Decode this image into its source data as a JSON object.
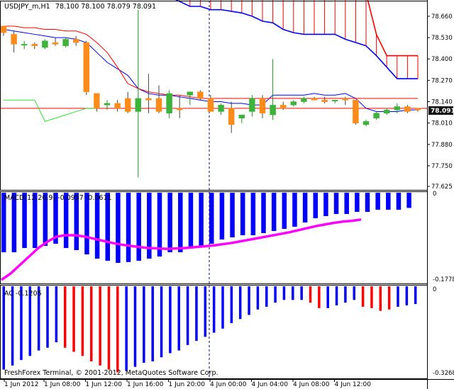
{
  "chart_data": [
    {
      "type": "candlestick",
      "title": "USDJPY_m,H1",
      "ohlc_text": "78.100 78.100 78.079 78.091",
      "current_price": "78.091",
      "price_ticks": [
        "78.660",
        "78.530",
        "78.400",
        "78.270",
        "78.140",
        "78.010",
        "77.880",
        "77.750",
        "77.625"
      ],
      "ylim": [
        77.625,
        78.72
      ],
      "time_ticks": [
        "1 Jun 2012",
        "1 Jun 08:00",
        "1 Jun 12:00",
        "1 Jun 16:00",
        "1 Jun 20:00",
        "4 Jun 00:00",
        "4 Jun 04:00",
        "4 Jun 08:00",
        "4 Jun 12:00"
      ],
      "candles": [
        [
          78.6,
          78.6,
          78.54,
          78.56
        ],
        [
          78.55,
          78.57,
          78.44,
          78.49
        ],
        [
          78.49,
          78.51,
          78.46,
          78.49
        ],
        [
          78.49,
          78.5,
          78.46,
          78.48
        ],
        [
          78.47,
          78.52,
          78.46,
          78.51
        ],
        [
          78.5,
          78.53,
          78.48,
          78.49
        ],
        [
          78.48,
          78.53,
          78.47,
          78.52
        ],
        [
          78.52,
          78.54,
          78.48,
          78.5
        ],
        [
          78.5,
          78.51,
          78.18,
          78.2
        ],
        [
          78.19,
          78.19,
          78.08,
          78.1
        ],
        [
          78.12,
          78.15,
          78.09,
          78.13
        ],
        [
          78.13,
          78.15,
          78.08,
          78.1
        ],
        [
          78.16,
          78.2,
          78.07,
          78.08
        ],
        [
          78.08,
          78.7,
          77.68,
          78.16
        ],
        [
          78.16,
          78.31,
          78.07,
          78.15
        ],
        [
          78.16,
          78.24,
          78.07,
          78.08
        ],
        [
          78.07,
          78.21,
          78.04,
          78.19
        ],
        [
          78.1,
          78.18,
          78.04,
          78.09
        ],
        [
          78.18,
          78.2,
          78.12,
          78.2
        ],
        [
          78.2,
          78.21,
          78.15,
          78.16
        ],
        [
          78.16,
          78.18,
          78.08,
          78.08
        ],
        [
          78.08,
          78.13,
          78.06,
          78.12
        ],
        [
          78.1,
          78.14,
          77.95,
          78.0
        ],
        [
          78.04,
          78.06,
          78.01,
          78.06
        ],
        [
          78.08,
          78.18,
          78.05,
          78.16
        ],
        [
          78.16,
          78.18,
          78.04,
          78.07
        ],
        [
          78.06,
          78.4,
          78.03,
          78.12
        ],
        [
          78.12,
          78.14,
          78.09,
          78.1
        ],
        [
          78.12,
          78.15,
          78.11,
          78.14
        ],
        [
          78.14,
          78.17,
          78.13,
          78.16
        ],
        [
          78.16,
          78.17,
          78.15,
          78.15
        ],
        [
          78.15,
          78.17,
          78.13,
          78.14
        ],
        [
          78.15,
          78.15,
          78.13,
          78.15
        ],
        [
          78.16,
          78.17,
          78.12,
          78.15
        ],
        [
          78.15,
          78.15,
          78.0,
          78.01
        ],
        [
          78.0,
          78.03,
          77.99,
          78.02
        ],
        [
          78.04,
          78.08,
          78.03,
          78.07
        ],
        [
          78.07,
          78.1,
          78.06,
          78.09
        ],
        [
          78.09,
          78.13,
          78.07,
          78.11
        ],
        [
          78.11,
          78.12,
          78.07,
          78.08
        ],
        [
          78.1,
          78.1,
          78.08,
          78.09
        ]
      ],
      "tenkan_sen": [
        78.58,
        78.57,
        78.56,
        78.55,
        78.54,
        78.53,
        78.53,
        78.52,
        78.5,
        78.44,
        78.38,
        78.34,
        78.3,
        78.22,
        78.19,
        78.18,
        78.18,
        78.17,
        78.16,
        78.15,
        78.14,
        78.14,
        78.13,
        78.13,
        78.12,
        78.12,
        78.18,
        78.18,
        78.18,
        78.18,
        78.19,
        78.18,
        78.18,
        78.19,
        78.16,
        78.1,
        78.08,
        78.08,
        78.08,
        78.09,
        78.09
      ],
      "kijun_sen": [
        78.6,
        78.6,
        78.59,
        78.59,
        78.58,
        78.58,
        78.57,
        78.57,
        78.55,
        78.5,
        78.44,
        78.35,
        78.25,
        78.22,
        78.2,
        78.19,
        78.18,
        78.18,
        78.17,
        78.16,
        78.16,
        78.16,
        78.16,
        78.16,
        78.16,
        78.16,
        78.16,
        78.16,
        78.16,
        78.16,
        78.16,
        78.16,
        78.16,
        78.16,
        78.16,
        78.16,
        78.16,
        78.16,
        78.16,
        78.16,
        78.16
      ],
      "chikou_span": [
        78.15,
        78.15,
        78.15,
        78.15,
        78.02,
        78.04,
        78.06,
        78.08,
        78.1,
        78.1
      ],
      "senkou_span_a": [
        78.8,
        78.8,
        78.78,
        78.75,
        78.72,
        78.72,
        78.7,
        78.7,
        78.69,
        78.68,
        78.66,
        78.63,
        78.62,
        78.58,
        78.56,
        78.55,
        78.55,
        78.55,
        78.55,
        78.52,
        78.5,
        78.48,
        78.42,
        78.35,
        78.28,
        78.28,
        78.28
      ],
      "senkou_span_b": [
        78.8,
        78.8,
        78.8,
        78.8,
        78.8,
        78.8,
        78.8,
        78.8,
        78.8,
        78.8,
        78.8,
        78.8,
        78.8,
        78.8,
        78.8,
        78.8,
        78.8,
        78.8,
        78.8,
        78.8,
        78.8,
        78.8,
        78.55,
        78.42,
        78.42,
        78.42,
        78.42
      ],
      "kumo_start_index": 14,
      "horizontal_line": 78.1,
      "colors": {
        "bull": "#3cb43c",
        "bear": "#ff8c1a",
        "tenkan": "#ff0000",
        "kijun": "#0000ff",
        "chikou": "#33dd33",
        "kumo": "#ff0000"
      }
    },
    {
      "type": "bar",
      "label": "MACD(12,26,9) -0.0957 -0.0611",
      "yticks": [
        "0",
        "-0.1778"
      ],
      "ylim": [
        -0.21,
        0
      ],
      "histogram": [
        -0.14,
        -0.14,
        -0.13,
        -0.13,
        -0.125,
        -0.12,
        -0.13,
        -0.135,
        -0.145,
        -0.155,
        -0.16,
        -0.165,
        -0.163,
        -0.16,
        -0.155,
        -0.15,
        -0.14,
        -0.14,
        -0.13,
        -0.125,
        -0.12,
        -0.11,
        -0.105,
        -0.1,
        -0.1,
        -0.095,
        -0.09,
        -0.085,
        -0.08,
        -0.07,
        -0.06,
        -0.055,
        -0.05,
        -0.05,
        -0.045,
        -0.045,
        -0.04,
        -0.04,
        -0.04,
        -0.0357
      ],
      "signal": [
        -0.205,
        -0.19,
        -0.17,
        -0.15,
        -0.13,
        -0.115,
        -0.103,
        -0.1,
        -0.1,
        -0.103,
        -0.108,
        -0.113,
        -0.118,
        -0.122,
        -0.125,
        -0.128,
        -0.13,
        -0.131,
        -0.132,
        -0.131,
        -0.13,
        -0.128,
        -0.126,
        -0.124,
        -0.121,
        -0.118,
        -0.114,
        -0.11,
        -0.106,
        -0.102,
        -0.098,
        -0.094,
        -0.089,
        -0.084,
        -0.079,
        -0.075,
        -0.071,
        -0.068,
        -0.066,
        -0.063
      ],
      "colors": {
        "histogram": "#0000ff",
        "signal": "#ff00ff"
      }
    },
    {
      "type": "bar",
      "label": "AC -0.1205",
      "yticks": [
        "0",
        "-0.3268"
      ],
      "ylim": [
        -0.3268,
        0
      ],
      "values": [
        -0.305,
        -0.29,
        -0.27,
        -0.255,
        -0.235,
        -0.225,
        -0.205,
        -0.225,
        -0.24,
        -0.255,
        -0.275,
        -0.29,
        -0.305,
        -0.315,
        -0.31,
        -0.295,
        -0.28,
        -0.275,
        -0.26,
        -0.245,
        -0.235,
        -0.215,
        -0.2,
        -0.185,
        -0.17,
        -0.155,
        -0.135,
        -0.12,
        -0.105,
        -0.085,
        -0.075,
        -0.06,
        -0.05,
        -0.05,
        -0.05,
        -0.06,
        -0.08,
        -0.08,
        -0.07,
        -0.06,
        -0.05,
        -0.075,
        -0.08,
        -0.09,
        -0.085,
        -0.075,
        -0.07,
        -0.065
      ],
      "bar_colors": [
        "#0000ff",
        "#0000ff",
        "#0000ff",
        "#0000ff",
        "#0000ff",
        "#0000ff",
        "#0000ff",
        "#ff0000",
        "#ff0000",
        "#ff0000",
        "#ff0000",
        "#ff0000",
        "#ff0000",
        "#ff0000",
        "#0000ff",
        "#0000ff",
        "#0000ff",
        "#0000ff",
        "#0000ff",
        "#0000ff",
        "#0000ff",
        "#0000ff",
        "#0000ff",
        "#0000ff",
        "#0000ff",
        "#0000ff",
        "#0000ff",
        "#0000ff",
        "#0000ff",
        "#0000ff",
        "#0000ff",
        "#0000ff",
        "#0000ff",
        "#0000ff",
        "#0000ff",
        "#ff0000",
        "#ff0000",
        "#0000ff",
        "#0000ff",
        "#0000ff",
        "#0000ff",
        "#ff0000",
        "#ff0000",
        "#ff0000",
        "#ff0000",
        "#0000ff",
        "#0000ff",
        "#0000ff"
      ]
    }
  ],
  "copyright": "FreshForex Terminal, © 2001-2012, MetaQuotes Software Corp."
}
